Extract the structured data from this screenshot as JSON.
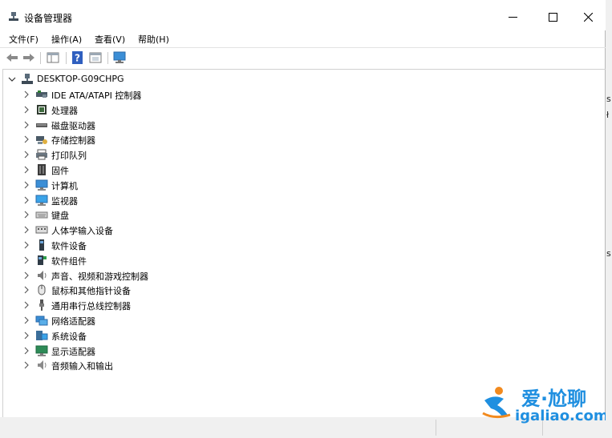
{
  "window": {
    "title": "设备管理器",
    "controls": {
      "minimize": "—",
      "maximize": "☐",
      "close": "✕"
    }
  },
  "menu": [
    {
      "label": "文件(F)"
    },
    {
      "label": "操作(A)"
    },
    {
      "label": "查看(V)"
    },
    {
      "label": "帮助(H)"
    }
  ],
  "toolbar": {
    "buttons": [
      "back-arrow-icon",
      "forward-arrow-icon",
      "properties-grid-icon",
      "help-icon",
      "update-driver-icon",
      "monitor-scan-icon"
    ]
  },
  "tree": {
    "root": {
      "label": "DESKTOP-G09CHPG",
      "expanded": true
    },
    "items": [
      {
        "label": "IDE ATA/ATAPI 控制器",
        "icon": "ide-controller-icon"
      },
      {
        "label": "处理器",
        "icon": "processor-icon"
      },
      {
        "label": "磁盘驱动器",
        "icon": "disk-drive-icon"
      },
      {
        "label": "存储控制器",
        "icon": "storage-controller-icon"
      },
      {
        "label": "打印队列",
        "icon": "printer-icon"
      },
      {
        "label": "固件",
        "icon": "firmware-icon"
      },
      {
        "label": "计算机",
        "icon": "computer-icon"
      },
      {
        "label": "监视器",
        "icon": "monitor-icon"
      },
      {
        "label": "键盘",
        "icon": "keyboard-icon"
      },
      {
        "label": "人体学输入设备",
        "icon": "hid-icon"
      },
      {
        "label": "软件设备",
        "icon": "software-device-icon"
      },
      {
        "label": "软件组件",
        "icon": "software-component-icon"
      },
      {
        "label": "声音、视频和游戏控制器",
        "icon": "sound-icon"
      },
      {
        "label": "鼠标和其他指针设备",
        "icon": "mouse-icon"
      },
      {
        "label": "通用串行总线控制器",
        "icon": "usb-icon"
      },
      {
        "label": "网络适配器",
        "icon": "network-adapter-icon"
      },
      {
        "label": "系统设备",
        "icon": "system-device-icon"
      },
      {
        "label": "显示适配器",
        "icon": "display-adapter-icon"
      },
      {
        "label": "音频输入和输出",
        "icon": "audio-io-icon"
      }
    ]
  },
  "watermark": {
    "brand": "爱·尬聊",
    "url": "igaliao.com"
  },
  "right_strip": {
    "chars": [
      "s",
      "ł",
      "s"
    ]
  },
  "colors": {
    "accent": "#1a7fd4",
    "text": "#000000",
    "watermark_blue": "#1f8fe0",
    "watermark_orange": "#f28a1e"
  }
}
